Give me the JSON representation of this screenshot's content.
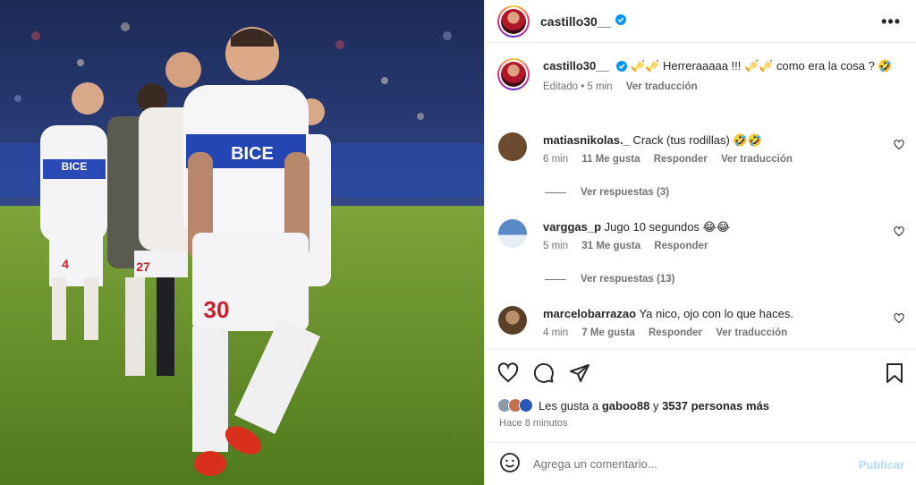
{
  "post": {
    "author": "castillo30__",
    "more_label": "•••",
    "photo_alt": "Jugador número 30 celebrando en el estadio"
  },
  "jersey": {
    "sponsor": "BICE",
    "number_main": "30",
    "number_left": "4",
    "number_mid": "27"
  },
  "caption": {
    "user": "castillo30__",
    "text": "🎺🎺 Herreraaaaa !!! 🎺🎺 como era la cosa ? 🤣",
    "edited": "Editado • 5 min",
    "translate": "Ver traducción"
  },
  "comments": [
    {
      "user": "matiasnikolas._",
      "text": "Crack (tus rodillas) 🤣🤣",
      "time": "6 min",
      "likes": "11 Me gusta",
      "reply": "Responder",
      "translate": "Ver traducción",
      "view_replies": "Ver respuestas (3)",
      "avatar_color": "#6b4a2e"
    },
    {
      "user": "varggas_p",
      "text": "Jugo 10 segundos 😂😂",
      "time": "5 min",
      "likes": "31 Me gusta",
      "reply": "Responder",
      "translate": "",
      "view_replies": "Ver respuestas (13)",
      "avatar_color": "#4a78b0"
    },
    {
      "user": "marcelobarrazao",
      "text": "Ya nico, ojo con lo que haces.",
      "time": "4 min",
      "likes": "7 Me gusta",
      "reply": "Responder",
      "translate": "Ver traducción",
      "view_replies": "",
      "avatar_color": "#7a5a3a"
    }
  ],
  "actions": {
    "likes_prefix": "Les gusta a",
    "liked_by": "gaboo88",
    "likes_joiner": "y",
    "likes_count": "3537 personas más",
    "time_ago": "Hace 8 minutos"
  },
  "composer": {
    "placeholder": "Agrega un comentario...",
    "publish": "Publicar"
  },
  "colors": {
    "verified": "#0095f6",
    "publish_disabled": "#b3dbff",
    "secondary_text": "#737373"
  }
}
